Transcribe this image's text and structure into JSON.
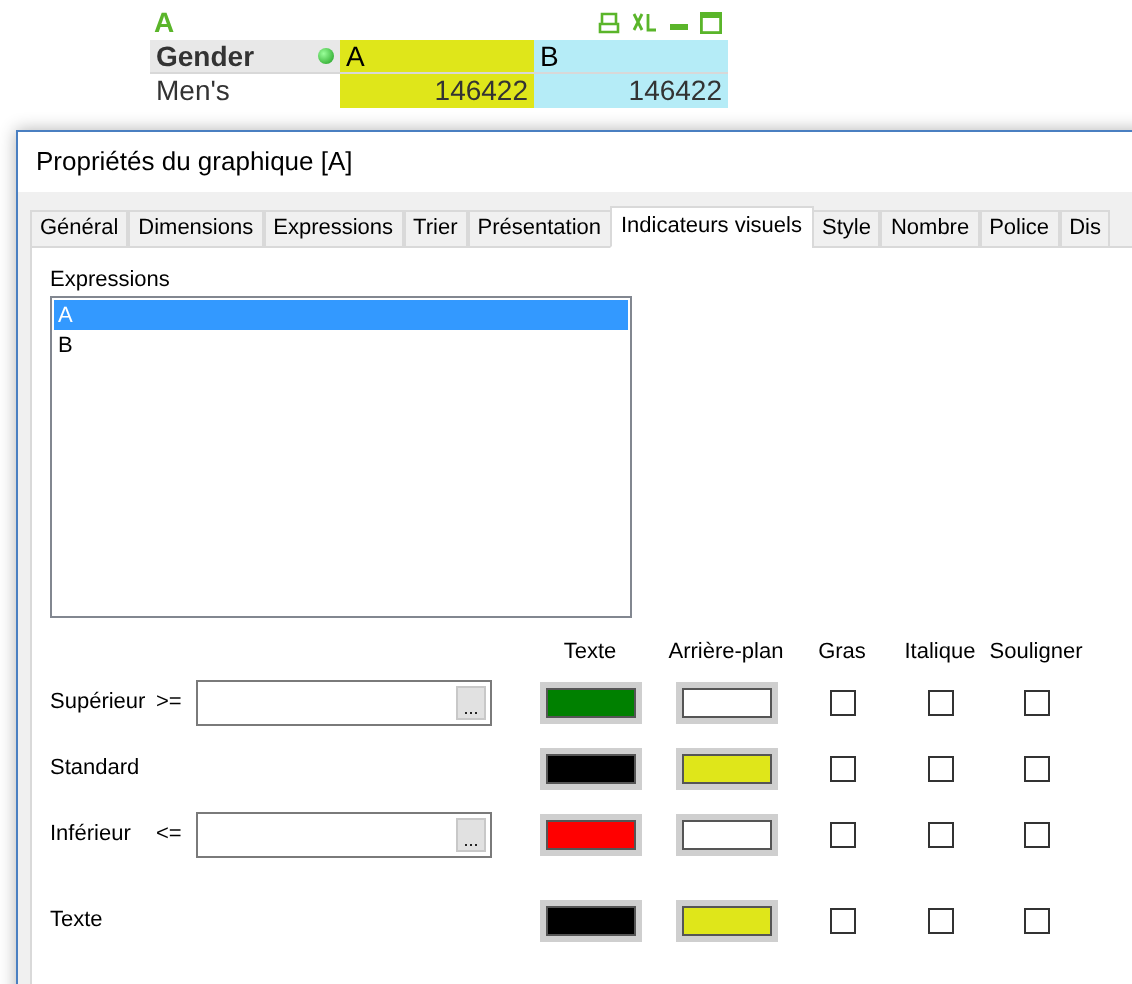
{
  "chart": {
    "title": "A",
    "columns": [
      {
        "label": "Gender",
        "color": "#e8e8e8"
      },
      {
        "label": "A",
        "color": "#dfe61a"
      },
      {
        "label": "B",
        "color": "#b5ecf7"
      }
    ],
    "rows": [
      [
        "Men's",
        "146422",
        "146422"
      ]
    ]
  },
  "dialog": {
    "title": "Propriétés du graphique [A]",
    "tabs": [
      {
        "label": "Général",
        "selected": false
      },
      {
        "label": "Dimensions",
        "selected": false
      },
      {
        "label": "Expressions",
        "selected": false
      },
      {
        "label": "Trier",
        "selected": false
      },
      {
        "label": "Présentation",
        "selected": false
      },
      {
        "label": "Indicateurs visuels",
        "selected": true
      },
      {
        "label": "Style",
        "selected": false
      },
      {
        "label": "Nombre",
        "selected": false
      },
      {
        "label": "Police",
        "selected": false
      },
      {
        "label": "Dis",
        "selected": false
      }
    ],
    "expressions_label": "Expressions",
    "expressions": [
      {
        "label": "A",
        "selected": true
      },
      {
        "label": "B",
        "selected": false
      }
    ],
    "columns": [
      "Texte",
      "Arrière-plan",
      "Gras",
      "Italique",
      "Souligner"
    ],
    "rows": [
      {
        "label": "Supérieur",
        "operator": ">=",
        "kind": "threshold",
        "button": "...",
        "swatches": [
          {
            "color": "#008000"
          },
          {
            "color": "#ffffff"
          }
        ],
        "bold": false,
        "italic": false,
        "underline": false
      },
      {
        "label": "Standard",
        "kind": "plain",
        "swatches": [
          {
            "color": "#000000"
          },
          {
            "color": "#dfe61a"
          }
        ],
        "bold": false,
        "italic": false,
        "underline": false
      },
      {
        "label": "Inférieur",
        "operator": "<=",
        "kind": "threshold",
        "button": "...",
        "swatches": [
          {
            "color": "#ff0000"
          },
          {
            "color": "#ffffff"
          }
        ],
        "bold": false,
        "italic": false,
        "underline": false
      },
      {
        "label": "Texte",
        "kind": "plain",
        "swatches": [
          {
            "color": "#000000"
          },
          {
            "color": "#dfe61a"
          }
        ],
        "bold": false,
        "italic": false,
        "underline": false
      }
    ]
  }
}
